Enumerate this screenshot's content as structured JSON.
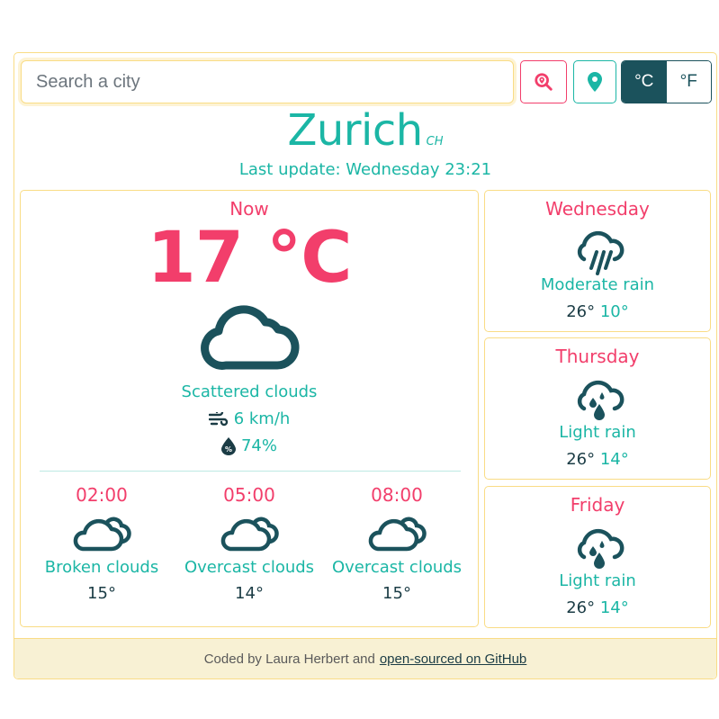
{
  "search": {
    "placeholder": "Search a city",
    "value": "",
    "search_button_icon": "search-location-icon",
    "location_button_icon": "map-pin-icon"
  },
  "units": {
    "celsius_label": "°C",
    "fahrenheit_label": "°F",
    "active": "celsius"
  },
  "header": {
    "city": "Zurich",
    "country": "CH",
    "last_update": "Last update: Wednesday 23:21"
  },
  "now": {
    "label": "Now",
    "temperature": "17 °C",
    "icon": "cloud-icon",
    "description": "Scattered clouds",
    "wind": "6 km/h",
    "wind_icon": "wind-icon",
    "humidity": "74%",
    "humidity_icon": "humidity-drop-icon"
  },
  "hourly": [
    {
      "time": "02:00",
      "icon": "broken-clouds-icon",
      "description": "Broken clouds",
      "temp": "15°"
    },
    {
      "time": "05:00",
      "icon": "overcast-clouds-icon",
      "description": "Overcast clouds",
      "temp": "14°"
    },
    {
      "time": "08:00",
      "icon": "overcast-clouds-icon",
      "description": "Overcast clouds",
      "temp": "15°"
    }
  ],
  "daily": [
    {
      "day": "Wednesday",
      "icon": "moderate-rain-icon",
      "description": "Moderate rain",
      "max": "26°",
      "min": "10°"
    },
    {
      "day": "Thursday",
      "icon": "light-rain-icon",
      "description": "Light rain",
      "max": "26°",
      "min": "14°"
    },
    {
      "day": "Friday",
      "icon": "light-rain-icon",
      "description": "Light rain",
      "max": "26°",
      "min": "14°"
    }
  ],
  "footer": {
    "text": "Coded by Laura Herbert and",
    "link_label": "open-sourced on GitHub"
  },
  "colors": {
    "accent_pink": "#f23e6b",
    "accent_teal": "#1bb6a5",
    "dark_teal": "#1b525c",
    "border_yellow": "#f9dc85",
    "footer_bg": "#f8f1d4"
  }
}
